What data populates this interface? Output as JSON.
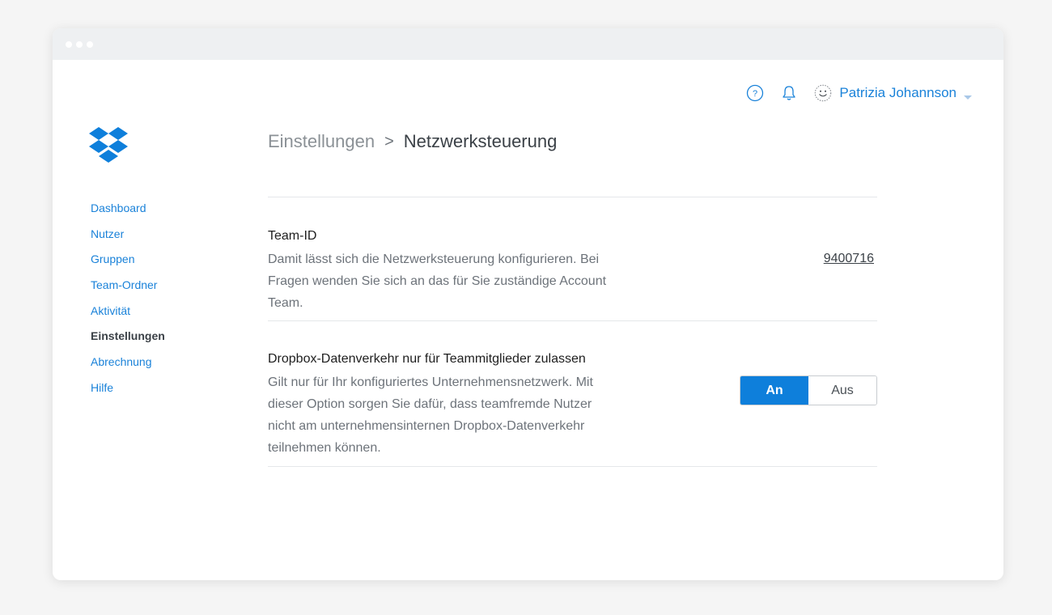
{
  "colors": {
    "accent": "#1a82d9",
    "toggle_active": "#0e7fdb",
    "text_dark": "#3b4147",
    "text_muted": "#6d737a"
  },
  "header": {
    "help_icon": "help-circle-icon",
    "bell_icon": "bell-icon",
    "avatar_icon": "smiley-avatar-icon",
    "user_name": "Patrizia Johannson"
  },
  "logo": {
    "icon": "dropbox-logo"
  },
  "sidebar": {
    "items": [
      {
        "label": "Dashboard",
        "active": false
      },
      {
        "label": "Nutzer",
        "active": false
      },
      {
        "label": "Gruppen",
        "active": false
      },
      {
        "label": "Team-Ordner",
        "active": false
      },
      {
        "label": "Aktivität",
        "active": false
      },
      {
        "label": "Einstellungen",
        "active": true
      },
      {
        "label": "Abrechnung",
        "active": false
      },
      {
        "label": "Hilfe",
        "active": false
      }
    ]
  },
  "breadcrumb": {
    "parent": "Einstellungen",
    "separator": ">",
    "current": "Netzwerksteuerung"
  },
  "settings": {
    "team_id": {
      "title": "Team-ID",
      "description": "Damit lässt sich die Netzwerksteuerung konfigurieren. Bei Fragen wenden Sie sich an das für Sie zuständige Account Team.",
      "value": "9400716"
    },
    "traffic": {
      "title": "Dropbox-Datenverkehr nur für Teammitglieder zulassen",
      "description": "Gilt nur für Ihr konfiguriertes Unternehmensnetzwerk. Mit dieser Option sorgen Sie dafür, dass teamfremde Nutzer nicht am unternehmensinternen Dropbox-Datenverkehr teilnehmen können.",
      "on_label": "An",
      "off_label": "Aus",
      "selected": "An"
    }
  }
}
